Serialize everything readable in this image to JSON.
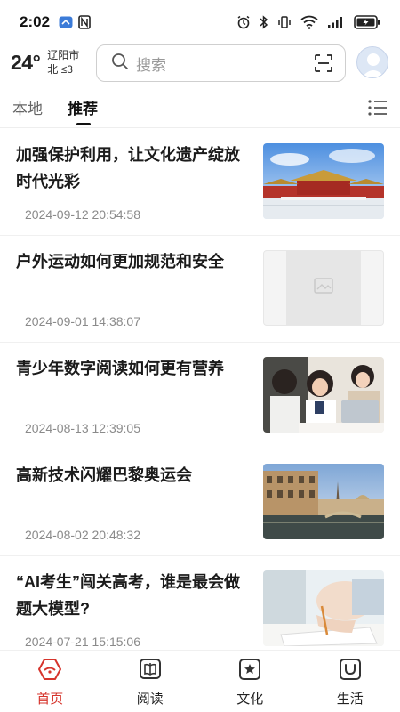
{
  "status_bar": {
    "time": "2:02",
    "left_icons": [
      "app-notification-icon",
      "nfc-icon"
    ],
    "right_icons": [
      "alarm-icon",
      "bluetooth-icon",
      "vibrate-icon",
      "wifi-icon",
      "signal-icon",
      "battery-icon"
    ]
  },
  "header": {
    "temperature": "24°",
    "city": "辽阳市",
    "wind": "北 ≤3",
    "search_placeholder": "搜索"
  },
  "tabs": [
    {
      "label": "本地",
      "active": false
    },
    {
      "label": "推荐",
      "active": true
    }
  ],
  "news": [
    {
      "title": "加强保护利用，让文化遗产绽放时代光彩",
      "time": "2024-09-12 20:54:58",
      "thumb": "palace"
    },
    {
      "title": "户外运动如何更加规范和安全",
      "time": "2024-09-01 14:38:07",
      "thumb": "placeholder"
    },
    {
      "title": "青少年数字阅读如何更有营养",
      "time": "2024-08-13 12:39:05",
      "thumb": "students"
    },
    {
      "title": "高新技术闪耀巴黎奥运会",
      "time": "2024-08-02 20:48:32",
      "thumb": "paris"
    },
    {
      "title": "“AI考生”闯关高考，谁是最会做题大模型?",
      "time": "2024-07-21 15:15:06",
      "thumb": "exam"
    }
  ],
  "bottom_nav": [
    {
      "label": "首页",
      "icon": "home-icon",
      "active": true
    },
    {
      "label": "阅读",
      "icon": "book-icon",
      "active": false
    },
    {
      "label": "文化",
      "icon": "culture-icon",
      "active": false
    },
    {
      "label": "生活",
      "icon": "life-icon",
      "active": false
    }
  ],
  "colors": {
    "accent": "#d6342c",
    "text": "#1b1b1b",
    "muted": "#8a8a8a"
  }
}
